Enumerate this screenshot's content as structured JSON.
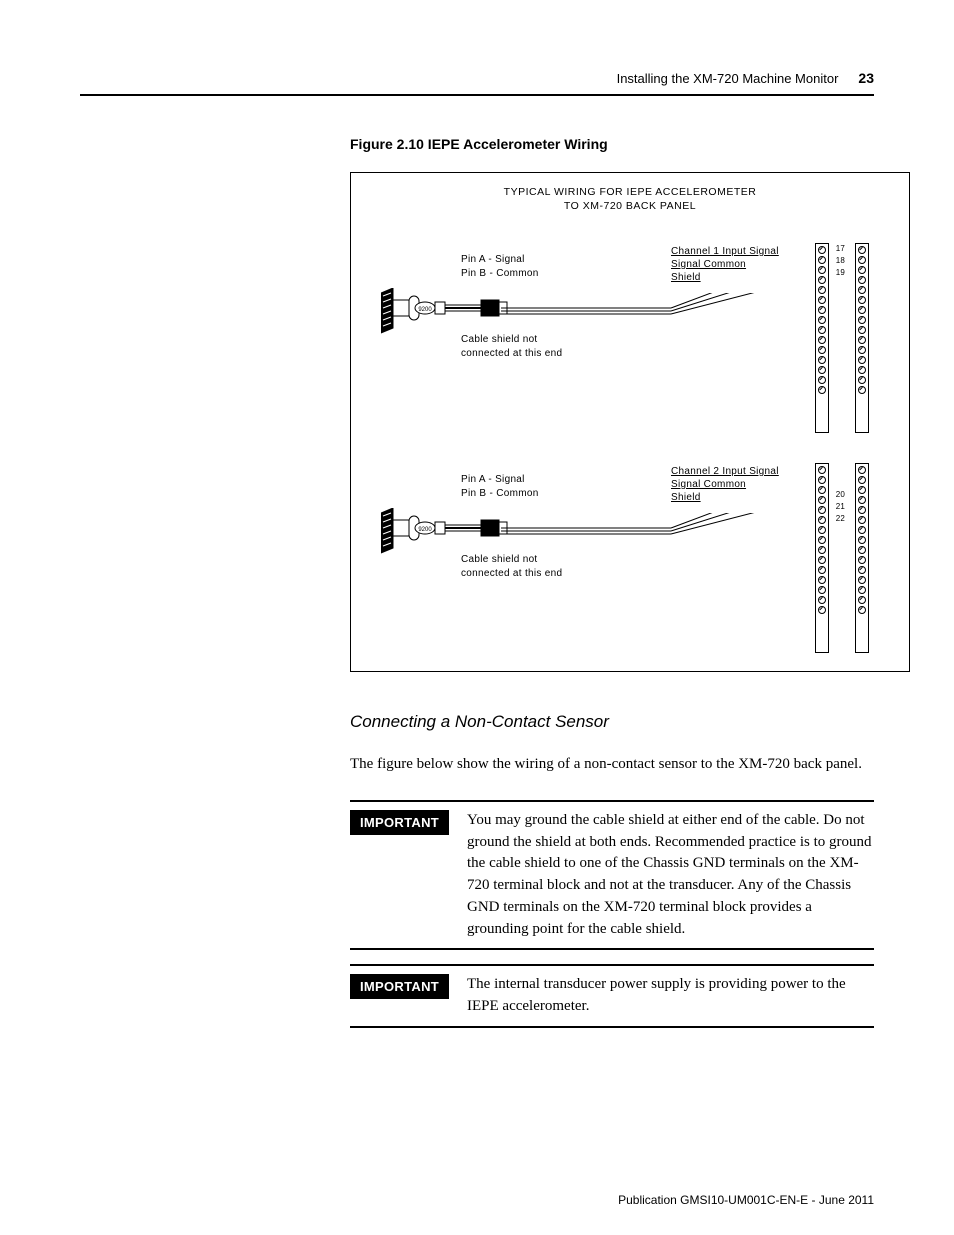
{
  "header": {
    "section": "Installing the XM-720 Machine Monitor",
    "page": "23"
  },
  "figure": {
    "caption": "Figure 2.10 IEPE Accelerometer Wiring",
    "title_line1": "TYPICAL WIRING FOR IEPE ACCELEROMETER",
    "title_line2": "TO XM-720 BACK PANEL",
    "pinA": "Pin A - Signal",
    "pinB": "Pin B - Common",
    "shield_note_l1": "Cable shield not",
    "shield_note_l2": "connected at this end",
    "ch1_sig1": "Channel 1 Input Signal",
    "ch1_sig2": "Signal Common",
    "ch1_sig3": "Shield",
    "ch1_t1": "17",
    "ch1_t2": "18",
    "ch1_t3": "19",
    "ch2_sig1": "Channel 2 Input Signal",
    "ch2_sig2": "Signal Common",
    "ch2_sig3": "Shield",
    "ch2_t1": "20",
    "ch2_t2": "21",
    "ch2_t3": "22"
  },
  "subheading": "Connecting a Non-Contact Sensor",
  "body": "The figure below show the wiring of a non-contact sensor to the XM-720 back panel.",
  "callouts": {
    "tag": "IMPORTANT",
    "c1": "You may ground the cable shield at either end of the cable. Do not ground the shield at both ends. Recommended practice is to ground the cable shield to one of the Chassis GND terminals on the XM-720 terminal block and not at the transducer. Any of the Chassis GND terminals on the XM-720 terminal block provides a grounding point for the cable shield.",
    "c2": "The internal transducer power supply is providing power to the IEPE accelerometer."
  },
  "footer": "Publication GMSI10-UM001C-EN-E - June 2011"
}
